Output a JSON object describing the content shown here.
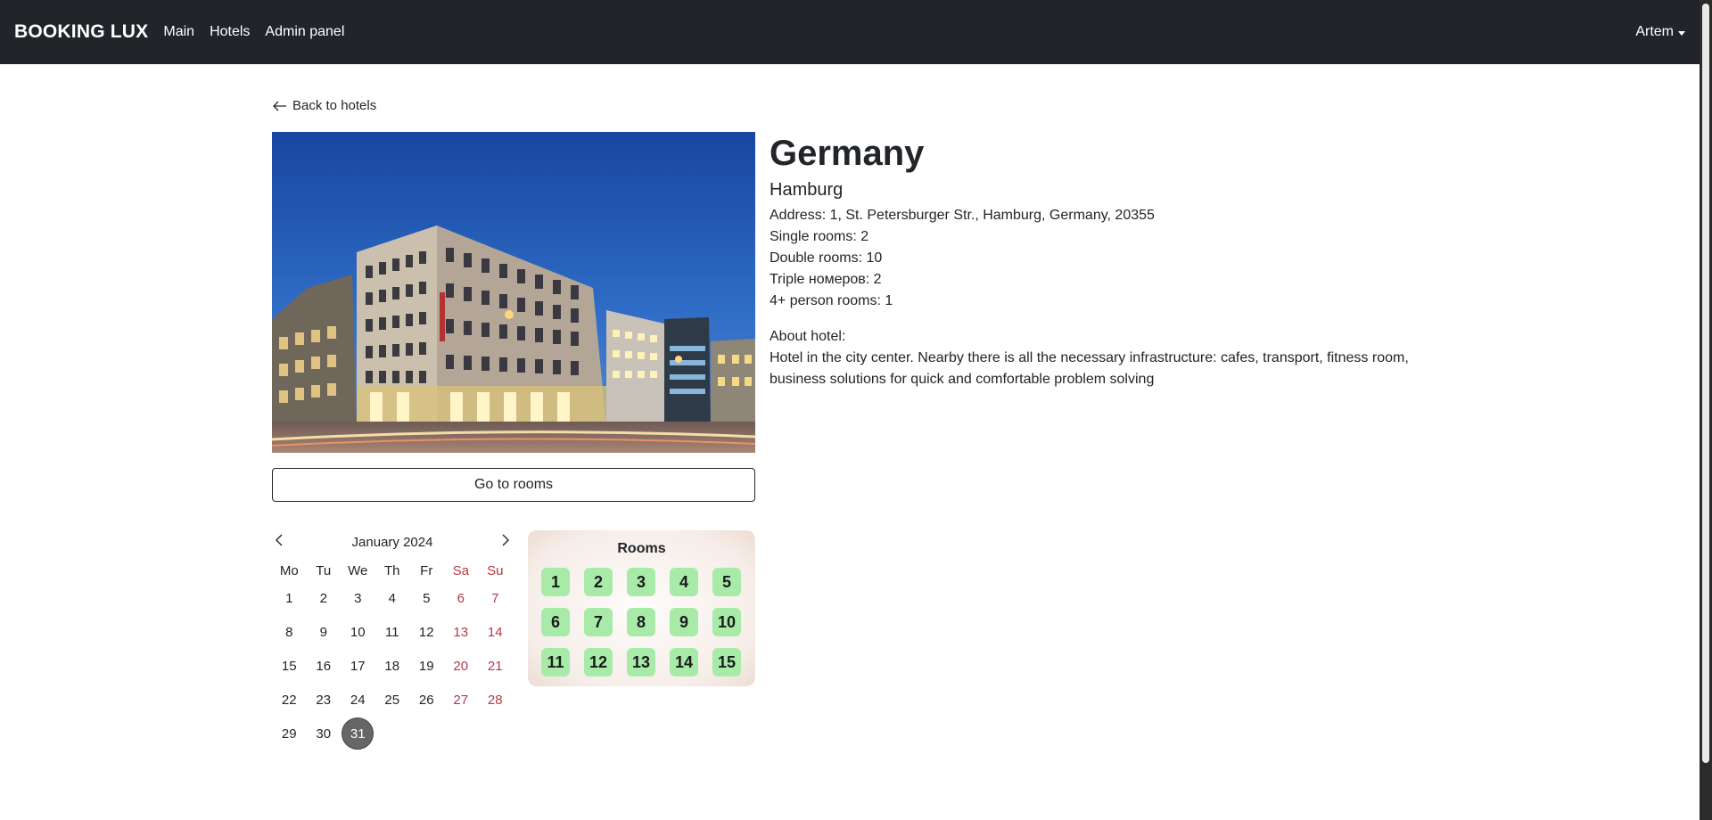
{
  "navbar": {
    "brand": "BOOKING LUX",
    "links": [
      "Main",
      "Hotels",
      "Admin panel"
    ],
    "user": "Artem"
  },
  "back_link": "Back to hotels",
  "hotel": {
    "country": "Germany",
    "city": "Hamburg",
    "details": [
      "Address: 1, St. Petersburger Str., Hamburg, Germany, 20355",
      "Single rooms: 2",
      "Double rooms: 10",
      "Triple номеров: 2",
      "4+ person rooms: 1"
    ],
    "about_label": "About hotel:",
    "about_text": "Hotel in the city center. Nearby there is all the necessary infrastructure: cafes, transport, fitness room, business solutions for quick and comfortable problem solving"
  },
  "go_rooms_label": "Go to rooms",
  "calendar": {
    "month": "January 2024",
    "weekdays": [
      "Mo",
      "Tu",
      "We",
      "Th",
      "Fr",
      "Sa",
      "Su"
    ],
    "days": [
      1,
      2,
      3,
      4,
      5,
      6,
      7,
      8,
      9,
      10,
      11,
      12,
      13,
      14,
      15,
      16,
      17,
      18,
      19,
      20,
      21,
      22,
      23,
      24,
      25,
      26,
      27,
      28,
      29,
      30,
      31
    ],
    "selected_day": 31
  },
  "rooms": {
    "title": "Rooms",
    "numbers": [
      "1",
      "2",
      "3",
      "4",
      "5",
      "6",
      "7",
      "8",
      "9",
      "10",
      "11",
      "12",
      "13",
      "14",
      "15"
    ],
    "available_color": "#a8eba8"
  },
  "colors": {
    "navbar_bg": "#212529",
    "weekend": "#b23a48"
  }
}
